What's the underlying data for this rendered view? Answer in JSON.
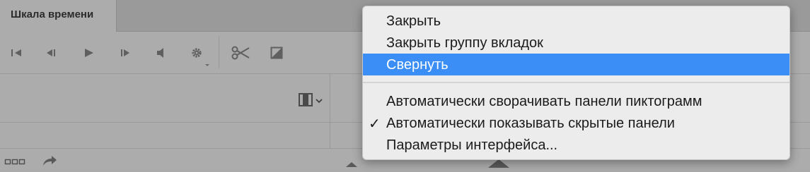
{
  "panel": {
    "tab_title": "Шкала времени"
  },
  "toolbar": {
    "icons": [
      "first-frame-icon",
      "previous-frame-icon",
      "play-icon",
      "next-frame-icon",
      "audio-icon",
      "settings-gear-icon",
      "scissors-icon",
      "transition-icon"
    ],
    "filmstrip_icon": "filmstrip-icon",
    "chevron_icon": "chevron-down-icon"
  },
  "bottombar": {
    "icons": [
      "frame-view-icon",
      "convert-arrow-icon",
      "zoom-out-mountain-icon",
      "zoom-in-mountain-icon"
    ]
  },
  "menu": {
    "items": [
      {
        "label": "Закрыть",
        "selected": false,
        "checked": false
      },
      {
        "label": "Закрыть группу вкладок",
        "selected": false,
        "checked": false
      },
      {
        "label": "Свернуть",
        "selected": true,
        "checked": false
      },
      {
        "label": "Автоматически сворачивать панели пиктограмм",
        "selected": false,
        "checked": false
      },
      {
        "label": "Автоматически показывать скрытые панели",
        "selected": false,
        "checked": true
      },
      {
        "label": "Параметры интерфейса...",
        "selected": false,
        "checked": false
      }
    ],
    "check_mark": "✓",
    "selection_color": "#3a8ef5"
  }
}
